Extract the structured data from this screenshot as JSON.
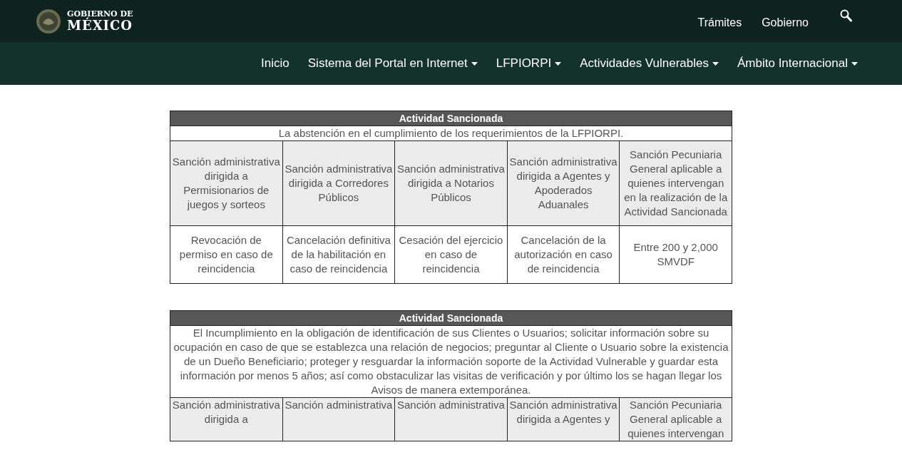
{
  "header": {
    "logo_line1": "GOBIERNO DE",
    "logo_line2": "MÉXICO",
    "links": [
      "Trámites",
      "Gobierno"
    ]
  },
  "nav": {
    "items": [
      {
        "label": "Inicio",
        "dropdown": false
      },
      {
        "label": "Sistema del Portal en Internet",
        "dropdown": true
      },
      {
        "label": "LFPIORPI",
        "dropdown": true
      },
      {
        "label": "Actividades Vulnerables",
        "dropdown": true
      },
      {
        "label": "Ámbito Internacional",
        "dropdown": true
      }
    ]
  },
  "tables": [
    {
      "title": "Actividad Sancionada",
      "description": "La abstención en el cumplimiento de los requerimientos de la LFPIORPI.",
      "headers": [
        "Sanción administrativa dirigida a Permisionarios de juegos y sorteos",
        "Sanción administrativa dirigida a Corredores Públicos",
        "Sanción administrativa dirigida a Notarios Públicos",
        "Sanción administrativa dirigida a Agentes y Apoderados Aduanales",
        "Sanción Pecuniaria General aplicable a quienes intervengan en la realización de la Actividad Sancionada"
      ],
      "rows": [
        [
          "Revocación de permiso en caso de reincidencia",
          "Cancelación definitiva de la habilitación en caso de reincidencia",
          "Cesación del ejercicio en caso de reincidencia",
          "Cancelación de la autorización en caso de reincidencia",
          "Entre 200 y 2,000 SMVDF"
        ]
      ]
    },
    {
      "title": "Actividad Sancionada",
      "description": "El Incumplimiento en la obligación de identificación de sus Clientes o Usuarios; solicitar información sobre su ocupación en caso de que se establezca una relación de negocios; preguntar al Cliente o Usuario sobre la existencia de un Dueño Beneficiario; proteger y resguardar la información soporte de la Actividad Vulnerable y guardar esta información por menos 5 años; así como obstaculizar las visitas de verificación y por último los se hagan llegar los Avisos de manera extemporánea.",
      "headers": [
        "Sanción administrativa dirigida a",
        "Sanción administrativa",
        "Sanción administrativa",
        "Sanción administrativa dirigida a Agentes y",
        "Sanción Pecuniaria General aplicable a quienes intervengan"
      ]
    }
  ]
}
